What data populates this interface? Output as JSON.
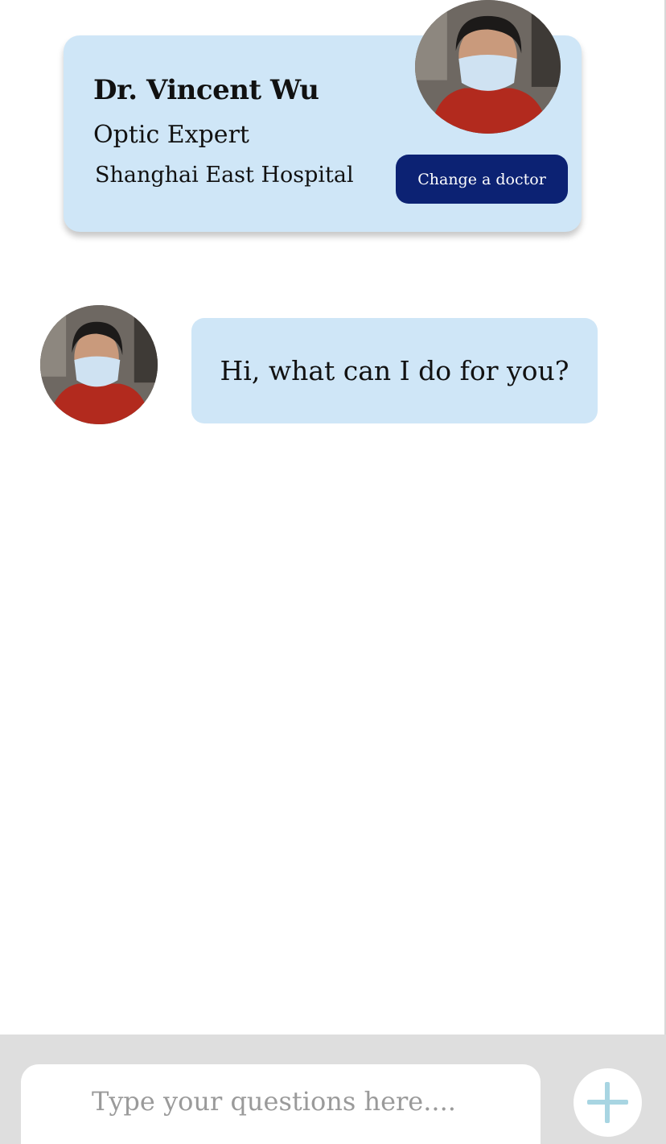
{
  "doctor": {
    "name": "Dr. Vincent Wu",
    "title": "Optic Expert",
    "hospital": "Shanghai East Hospital",
    "change_button_label": "Change a doctor",
    "avatar_icon": "doctor-avatar-photo"
  },
  "chat": {
    "messages": [
      {
        "sender": "doctor",
        "text": "Hi, what can I do for you?"
      }
    ]
  },
  "composer": {
    "placeholder": "Type your questions here....",
    "value": "",
    "add_icon": "plus-icon"
  },
  "colors": {
    "card_background": "#cfe6f7",
    "button_background": "#0c2273",
    "input_bar_background": "#dedede",
    "plus_icon": "#a8d5e2"
  }
}
